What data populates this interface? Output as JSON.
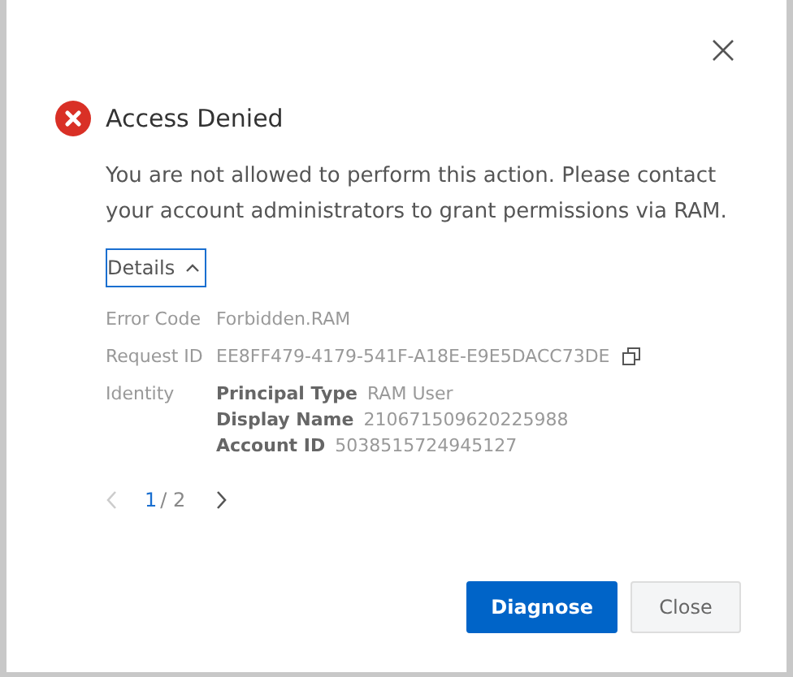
{
  "dialog": {
    "title": "Access Denied",
    "message": "You are not allowed to perform this action. Please contact your account administrators to grant permissions via RAM.",
    "details_toggle": {
      "label": "Details",
      "expanded": true
    },
    "details": [
      {
        "kind": "text",
        "label": "Error Code",
        "value": "Forbidden.RAM"
      },
      {
        "kind": "copy",
        "label": "Request ID",
        "value": "EE8FF479-4179-541F-A18E-E9E5DACC73DE"
      },
      {
        "kind": "identity",
        "label": "Identity",
        "fields": [
          {
            "label": "Principal Type",
            "value": "RAM User"
          },
          {
            "label": "Display Name",
            "value": "210671509620225988"
          },
          {
            "label": "Account ID",
            "value": "5038515724945127"
          }
        ]
      }
    ],
    "pager": {
      "current": "1",
      "total": "/ 2",
      "prev_disabled": true,
      "next_disabled": false
    },
    "buttons": [
      {
        "label": "Diagnose",
        "kind": "primary"
      },
      {
        "label": "Close",
        "kind": "secondary"
      }
    ]
  }
}
